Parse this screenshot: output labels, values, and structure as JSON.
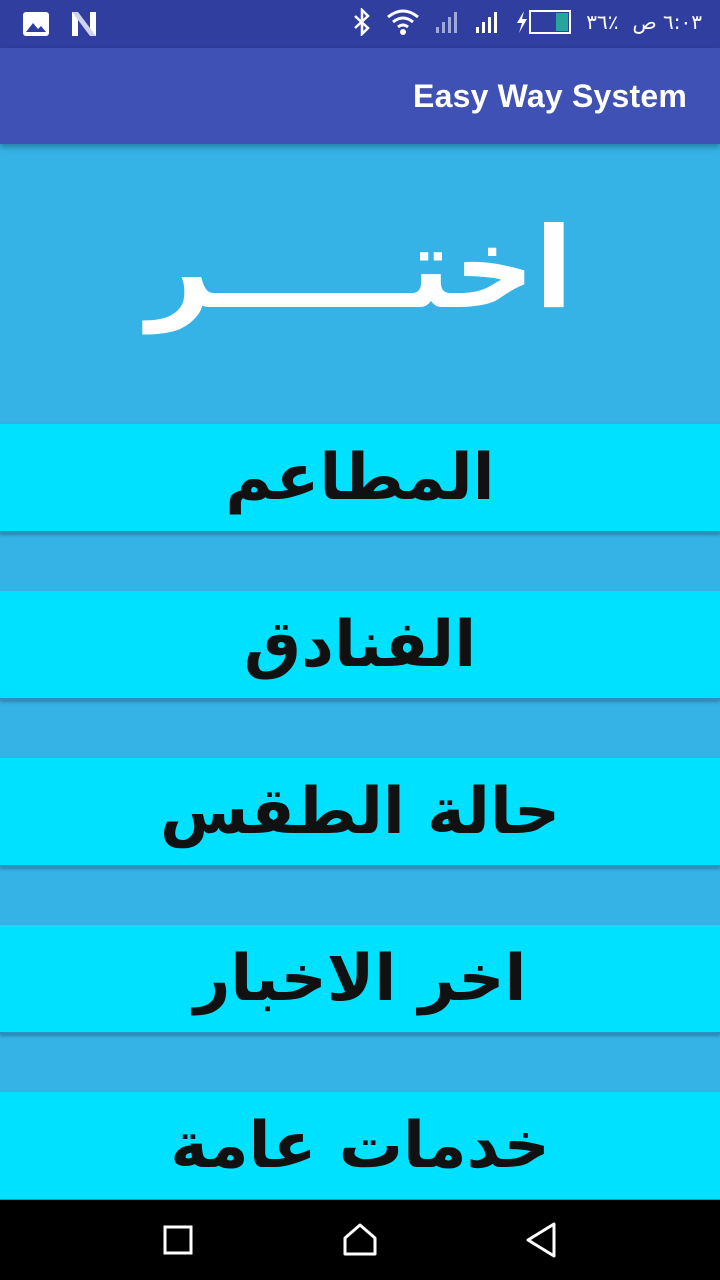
{
  "status_bar": {
    "time": "٦:٠٣ ص",
    "battery": "٣٦٪"
  },
  "app_bar": {
    "title": "Easy Way System"
  },
  "header": {
    "text": "اختـــــر"
  },
  "menu": [
    {
      "label": "المطاعم"
    },
    {
      "label": "الفنادق"
    },
    {
      "label": "حالة الطقس"
    },
    {
      "label": "اخر الاخبار"
    },
    {
      "label": "خدمات عامة"
    }
  ],
  "colors": {
    "background": "#35b3e6",
    "item": "#00e0ff",
    "appbar": "#3f51b5",
    "statusbar": "#303f9f"
  }
}
